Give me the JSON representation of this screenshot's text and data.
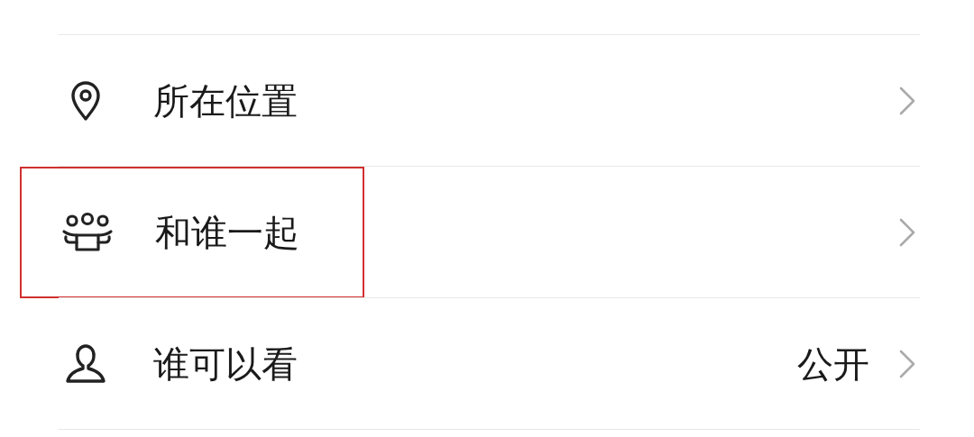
{
  "rows": [
    {
      "kind": "location",
      "label": "所在位置",
      "highlighted": false
    },
    {
      "kind": "group",
      "label": "和谁一起",
      "highlighted": true
    },
    {
      "kind": "person",
      "label": "谁可以看",
      "value": "公开",
      "highlighted": false
    }
  ]
}
